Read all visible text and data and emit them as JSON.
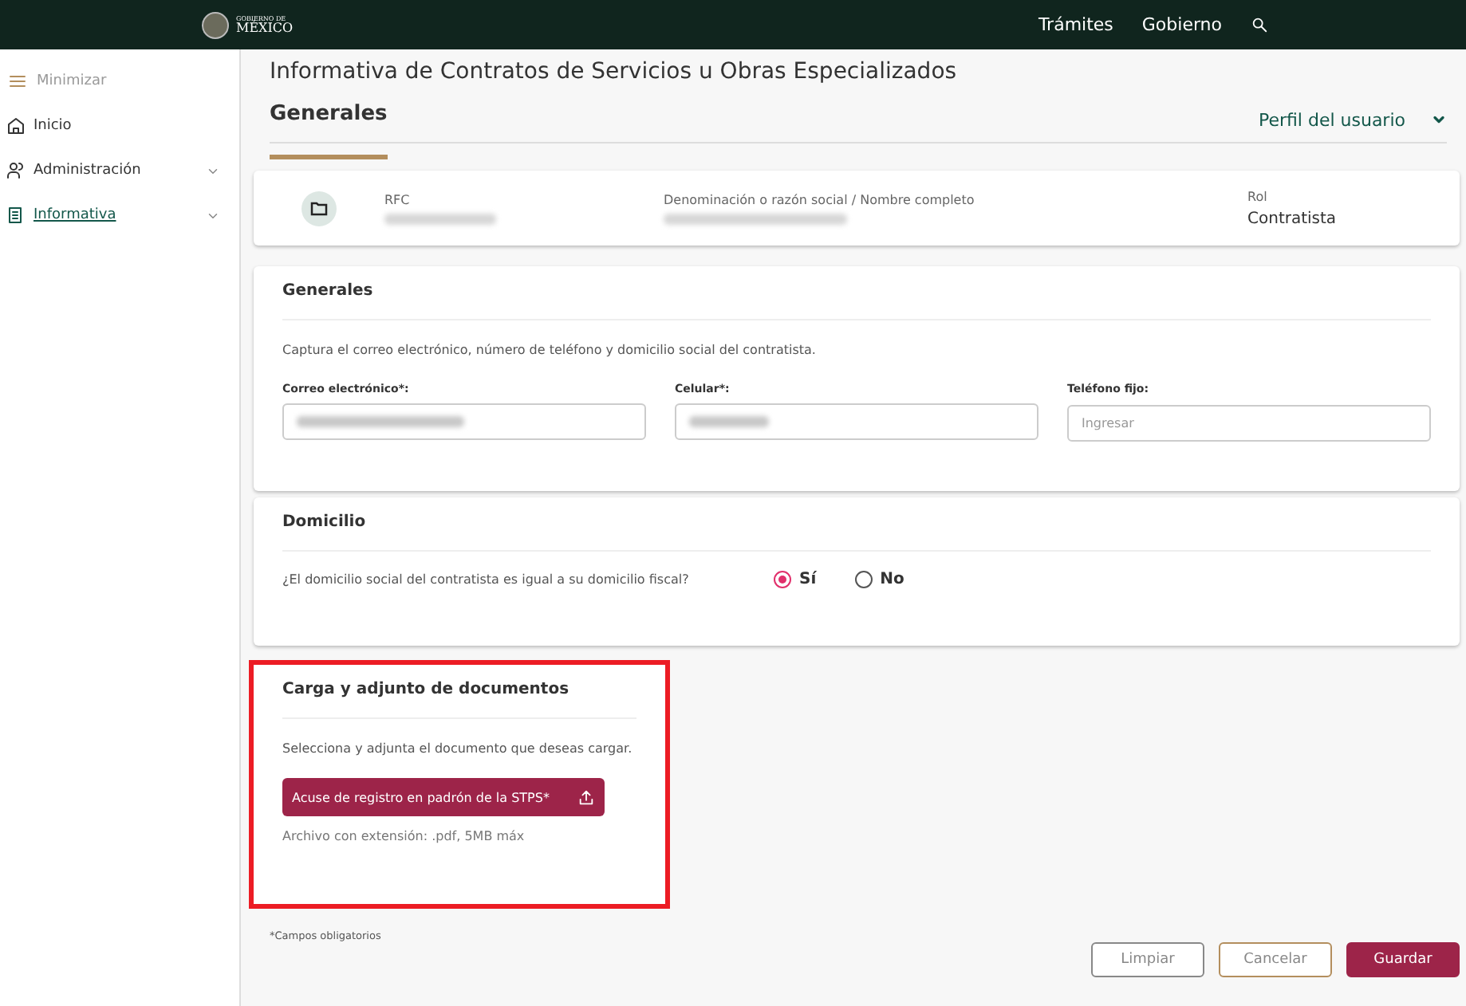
{
  "header": {
    "logo_small": "GOBIERNO DE",
    "logo_big": "MÉXICO",
    "links": [
      "Trámites",
      "Gobierno"
    ]
  },
  "sidebar": {
    "toggle": "Minimizar",
    "items": [
      {
        "label": "Inicio",
        "kind": "home",
        "expandable": false,
        "selected": false
      },
      {
        "label": "Administración",
        "kind": "people",
        "expandable": true,
        "selected": false
      },
      {
        "label": "Informativa",
        "kind": "doc",
        "expandable": true,
        "selected": true
      }
    ]
  },
  "page_title": "Informativa de Contratos de Servicios u Obras Especializados",
  "tab": {
    "label": "Generales",
    "selected": true
  },
  "profile_toggle": "Perfil del usuario",
  "info": {
    "fields": [
      {
        "label": "RFC"
      },
      {
        "label": "Denominación o razón social / Nombre completo"
      },
      {
        "label": "Rol",
        "value": "Contratista"
      }
    ]
  },
  "generales": {
    "title": "Generales",
    "description": "Captura el correo electrónico, número de teléfono y domicilio social del contratista.",
    "fields": [
      {
        "label": "Correo electrónico*:"
      },
      {
        "label": "Celular*:"
      },
      {
        "label": "Teléfono fijo:",
        "placeholder": "Ingresar"
      }
    ]
  },
  "domicilio": {
    "title": "Domicilio",
    "question": "¿El domicilio social del contratista es igual a su domicilio fiscal?",
    "options": [
      {
        "label": "Sí",
        "selected": true
      },
      {
        "label": "No",
        "selected": false
      }
    ]
  },
  "documentos": {
    "title": "Carga y adjunto de documentos",
    "highlighted": true,
    "description": "Selecciona y adjunta el documento que deseas cargar.",
    "upload_button": "Acuse de registro en padrón de la STPS*",
    "hint": "Archivo con extensión: .pdf, 5MB máx"
  },
  "footnote": "*Campos obligatorios",
  "buttons": [
    {
      "label": "Limpiar",
      "kind": "plain"
    },
    {
      "label": "Cancelar",
      "kind": "gold"
    },
    {
      "label": "Guardar",
      "kind": "primary"
    }
  ]
}
